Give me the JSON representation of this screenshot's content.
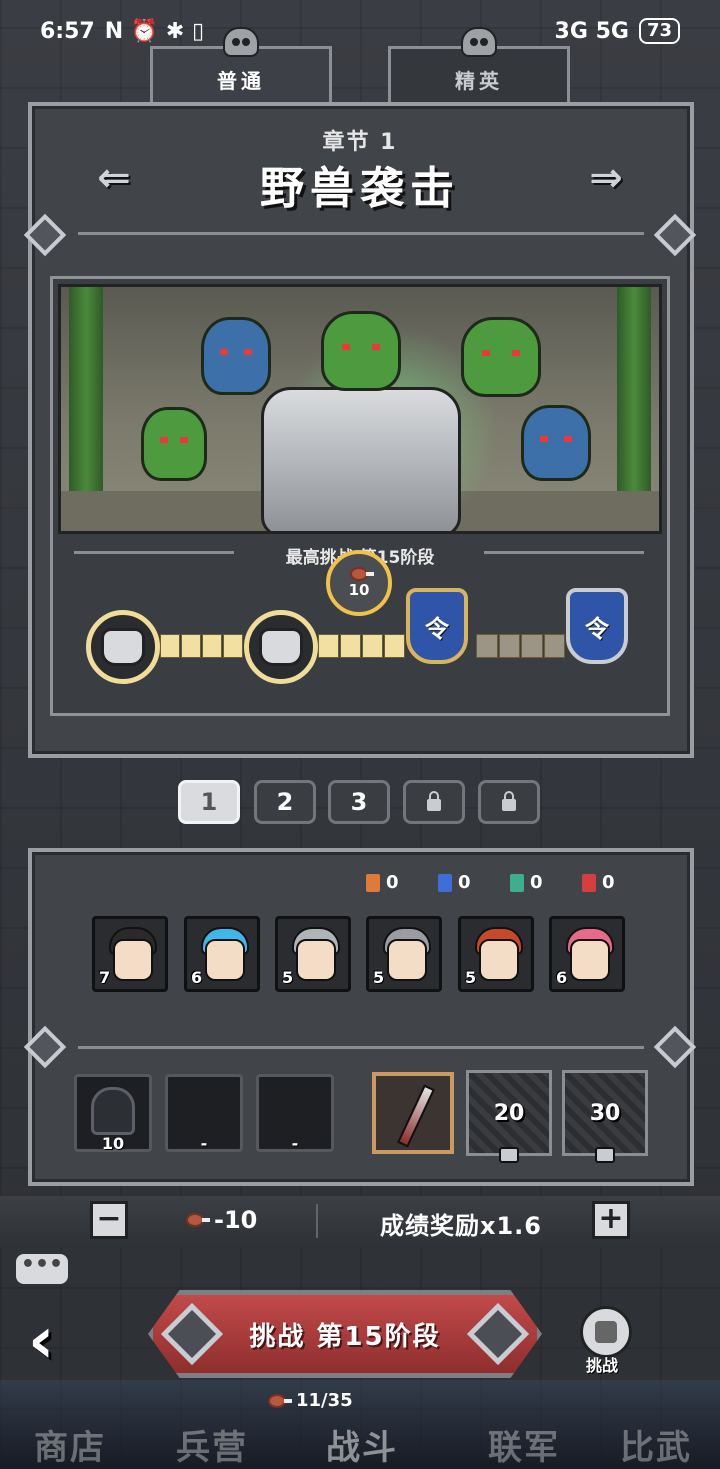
{
  "status": {
    "time": "6:57",
    "icons": "N ⏰ ✱ ▯",
    "net": "3G 5G",
    "battery": "73"
  },
  "tabs": [
    {
      "label": "普通"
    },
    {
      "label": "精英"
    }
  ],
  "chapter": {
    "label": "章节 1",
    "title": "野兽袭击",
    "prev": "⇐",
    "next": "⇒"
  },
  "progress": {
    "best_stage": "最高挑战 第15阶段",
    "reward_amount": "10",
    "milestone_glyph": "令",
    "filled_segments": 8,
    "total_segments": 12
  },
  "pages": [
    "1",
    "2",
    "3"
  ],
  "stats": [
    {
      "value": "0",
      "color": "#e07a3a"
    },
    {
      "value": "0",
      "color": "#3f6fd6"
    },
    {
      "value": "0",
      "color": "#3fae8f"
    },
    {
      "value": "0",
      "color": "#d63f3f"
    }
  ],
  "heroes": [
    {
      "level": "7",
      "hair": "#2a2a2a"
    },
    {
      "level": "6",
      "hair": "#3fb7e8"
    },
    {
      "level": "5",
      "hair": "#b0b3b8"
    },
    {
      "level": "5",
      "hair": "#9a9ca1"
    },
    {
      "level": "5",
      "hair": "#c64a2a"
    },
    {
      "level": "6",
      "hair": "#e86a8a"
    }
  ],
  "slots": [
    {
      "caption": "10"
    },
    {
      "caption": "-"
    },
    {
      "caption": "-"
    }
  ],
  "locked_slots": [
    "20",
    "30"
  ],
  "cost": {
    "minus": "−",
    "plus": "+",
    "value": "-10",
    "bonus": "成绩奖励x1.6"
  },
  "challenge": {
    "label": "挑战 第15阶段",
    "side_label": "挑战",
    "energy": "11/35"
  },
  "nav": [
    "商店",
    "兵营",
    "战斗",
    "联军",
    "比武"
  ],
  "colors": {
    "accent_gold": "#f0dd9a",
    "challenge_red": "#b23e3e",
    "banner_blue": "#2e55a8"
  }
}
